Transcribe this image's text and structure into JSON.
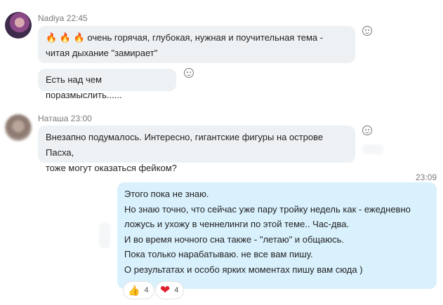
{
  "messages": [
    {
      "sender": "Nadiya",
      "time": "22:45",
      "bubbles": [
        {
          "line1": "🔥 🔥 🔥  очень горячая, глубокая, нужная и поучительная тема -",
          "line2": "читая  дыхание \"замирает\""
        },
        {
          "line1": "Есть над чем поразмыслить......"
        }
      ]
    },
    {
      "sender": "Наташа",
      "time": "23:00",
      "bubbles": [
        {
          "line1": "Внезапно подумалось. Интересно, гигантские фигуры на острове Пасха,",
          "line2": "тоже могут оказаться фейком?"
        }
      ]
    }
  ],
  "outgoing": {
    "time": "23:09",
    "lines": [
      "Этого пока не знаю.",
      "Но знаю точно, что сейчас уже пару тройку недель как - ежедневно",
      "ложусь и ухожу в ченнелинги по этой теме.. Час-два.",
      "И во время ночного сна также - \"летаю\" и общаюсь.",
      "Пока только нарабатываю. не все вам пишу.",
      "О результатах и особо ярких моментах пишу вам сюда )"
    ],
    "reactions": [
      {
        "icon": "thumbs-up-icon",
        "emoji": "👍",
        "count": "4"
      },
      {
        "icon": "heart-icon",
        "emoji": "❤",
        "count": "4"
      }
    ]
  },
  "colors": {
    "incoming_bubble": "#eef1f4",
    "outgoing_bubble": "#d9f1fd",
    "meta_text": "#7a7a7a",
    "heart": "#e0202e"
  }
}
